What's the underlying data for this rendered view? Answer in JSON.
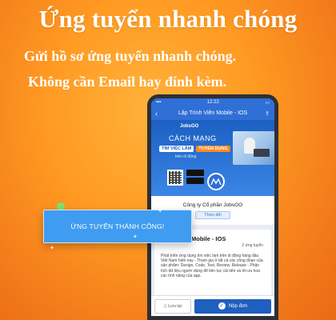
{
  "headline": "Ứng tuyển nhanh chóng",
  "sublines": [
    "Gửi hồ sơ ứng tuyển nhanh chóng.",
    "Không cần Email hay đính kèm."
  ],
  "phone": {
    "status_time": "12:22",
    "nav_title": "Lập Trình Viên Mobile - IOS",
    "banner": {
      "brand": "JobsGO",
      "headline": "CÁCH MẠNG",
      "tag1": "TÌM VIỆC LÀM",
      "tag2": "TUYỂN DỤNG",
      "tagline": "trên di động",
      "logo_text": "JobsGO"
    },
    "company": {
      "name": "Công ty Cổ phần JobsGO",
      "follow_label": "Theo dõi"
    },
    "job": {
      "title": "Mobile - IOS",
      "meta": "2 ứng tuyển",
      "description": "Phát triển ứng dụng tìm việc làm trên di động hàng đầu Việt Nam hiện nay - Tham gia ở tất cả các công đoạn của sản phẩm: Design, Code, Test, Review, Release - Phân tích dữ liệu người dùng để liên tục cải tiến và tối ưu hoá các tính năng của app.",
      "more": "..."
    },
    "bottom": {
      "save_label": "Lưu lại",
      "apply_label": "Nộp đơn"
    }
  },
  "popup": {
    "message": "ỨNG TUYỂN THÀNH CÔNG!"
  },
  "colors": {
    "background": "#ff9a22",
    "primary_blue": "#2f6fd6",
    "popup_blue": "#3f9cf0",
    "accent_green": "#7ee06a"
  }
}
